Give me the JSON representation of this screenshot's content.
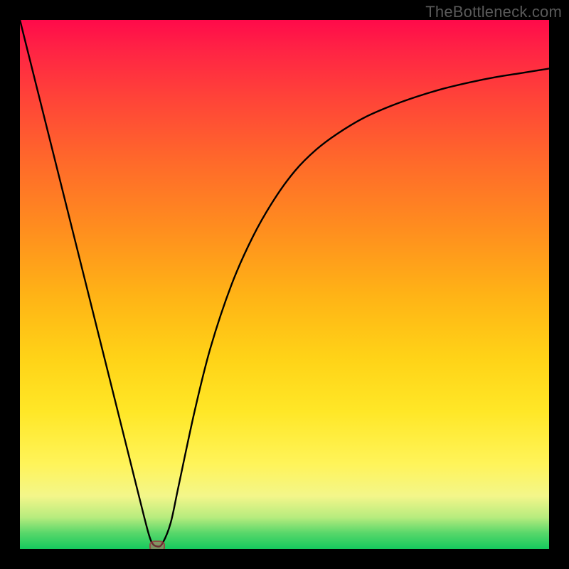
{
  "watermark": "TheBottleneck.com",
  "chart_data": {
    "type": "line",
    "title": "",
    "xlabel": "",
    "ylabel": "",
    "xlim": [
      0,
      100
    ],
    "ylim": [
      0,
      100
    ],
    "grid": false,
    "series": [
      {
        "name": "curve",
        "color": "#000000",
        "x": [
          0,
          3,
          6,
          9,
          12,
          15,
          18,
          21,
          23.5,
          24.8,
          26,
          27,
          28.5,
          30,
          33,
          36,
          40,
          44,
          48,
          52,
          56,
          60,
          65,
          70,
          75,
          80,
          85,
          90,
          95,
          100
        ],
        "y": [
          100,
          88,
          76,
          64,
          52,
          40,
          28,
          16,
          6,
          1.5,
          0.5,
          1.2,
          5,
          12,
          26,
          38,
          50,
          59,
          66,
          71.5,
          75.5,
          78.5,
          81.5,
          83.7,
          85.5,
          87,
          88.2,
          89.2,
          90,
          90.8
        ]
      }
    ],
    "marker": {
      "x": 26,
      "y": 0.5
    },
    "background_gradient": {
      "orientation": "vertical",
      "stops": [
        {
          "pos": 0.0,
          "color": "#ff0a4a"
        },
        {
          "pos": 0.05,
          "color": "#ff2145"
        },
        {
          "pos": 0.15,
          "color": "#ff4438"
        },
        {
          "pos": 0.27,
          "color": "#ff6a2a"
        },
        {
          "pos": 0.4,
          "color": "#ff8f1e"
        },
        {
          "pos": 0.52,
          "color": "#ffb316"
        },
        {
          "pos": 0.64,
          "color": "#ffd317"
        },
        {
          "pos": 0.74,
          "color": "#ffe727"
        },
        {
          "pos": 0.84,
          "color": "#fff45a"
        },
        {
          "pos": 0.9,
          "color": "#f3f68a"
        },
        {
          "pos": 0.94,
          "color": "#b7ec7e"
        },
        {
          "pos": 0.97,
          "color": "#57d76a"
        },
        {
          "pos": 1.0,
          "color": "#14c95d"
        }
      ]
    }
  }
}
